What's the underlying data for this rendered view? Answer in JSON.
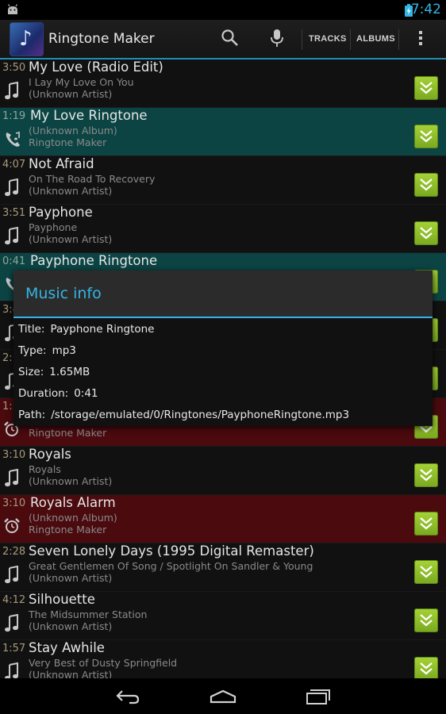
{
  "status": {
    "time": "7:42"
  },
  "actionbar": {
    "title": "Ringtone Maker",
    "tracks_label": "TRACKS",
    "albums_label": "ALBUMS"
  },
  "colors": {
    "accent": "#33b5e5",
    "ringtone_row": "#0c4444",
    "alarm_row": "#4a0a0e",
    "music_row": "#111111",
    "download_button": "#93c52b"
  },
  "list": [
    {
      "type": "music",
      "icon": "music-note-icon",
      "duration": "3:50",
      "title": "My Love (Radio Edit)",
      "sub1": "I Lay My Love On You",
      "sub2": "(Unknown Artist)"
    },
    {
      "type": "ringtone",
      "icon": "phone-ringtone-icon",
      "duration": "1:19",
      "title": "My Love Ringtone",
      "sub1": "(Unknown Album)",
      "sub2": "Ringtone Maker"
    },
    {
      "type": "music",
      "icon": "music-note-icon",
      "duration": "4:07",
      "title": "Not Afraid",
      "sub1": "On The Road To Recovery",
      "sub2": "(Unknown Artist)"
    },
    {
      "type": "music",
      "icon": "music-note-icon",
      "duration": "3:51",
      "title": "Payphone",
      "sub1": "Payphone",
      "sub2": "(Unknown Artist)"
    },
    {
      "type": "ringtone",
      "icon": "phone-ringtone-icon",
      "duration": "0:41",
      "title": "Payphone Ringtone",
      "sub1": "",
      "sub2": ""
    },
    {
      "type": "music",
      "icon": "music-note-icon",
      "duration": "3:4",
      "title": "",
      "sub1": "",
      "sub2": ""
    },
    {
      "type": "music",
      "icon": "music-note-icon",
      "duration": "2:",
      "title": "",
      "sub1": "",
      "sub2": ""
    },
    {
      "type": "alarm",
      "icon": "alarm-clock-icon",
      "duration": "1:",
      "title": "",
      "sub1": "",
      "sub2": "Ringtone Maker"
    },
    {
      "type": "music",
      "icon": "music-note-icon",
      "duration": "3:10",
      "title": "Royals",
      "sub1": "Royals",
      "sub2": "(Unknown Artist)"
    },
    {
      "type": "alarm",
      "icon": "alarm-clock-icon",
      "duration": "3:10",
      "title": "Royals Alarm",
      "sub1": "(Unknown Album)",
      "sub2": "Ringtone Maker"
    },
    {
      "type": "music",
      "icon": "music-note-icon",
      "duration": "2:28",
      "title": "Seven Lonely Days (1995 Digital Remaster)",
      "sub1": "Great Gentlemen Of Song / Spotlight On Sandler & Young",
      "sub2": "(Unknown Artist)"
    },
    {
      "type": "music",
      "icon": "music-note-icon",
      "duration": "4:12",
      "title": "Silhouette",
      "sub1": "The Midsummer Station",
      "sub2": "(Unknown Artist)"
    },
    {
      "type": "music",
      "icon": "music-note-icon",
      "duration": "1:57",
      "title": "Stay Awhile",
      "sub1": "Very Best of Dusty Springfield",
      "sub2": "(Unknown Artist)"
    }
  ],
  "dialog": {
    "title": "Music info",
    "rows": [
      {
        "key": "Title:",
        "value": "Payphone Ringtone"
      },
      {
        "key": "Type:",
        "value": "mp3"
      },
      {
        "key": "Size:",
        "value": "1.65MB"
      },
      {
        "key": "Duration:",
        "value": "0:41"
      },
      {
        "key": "Path:",
        "value": "/storage/emulated/0/Ringtones/PayphoneRingtone.mp3"
      }
    ]
  }
}
